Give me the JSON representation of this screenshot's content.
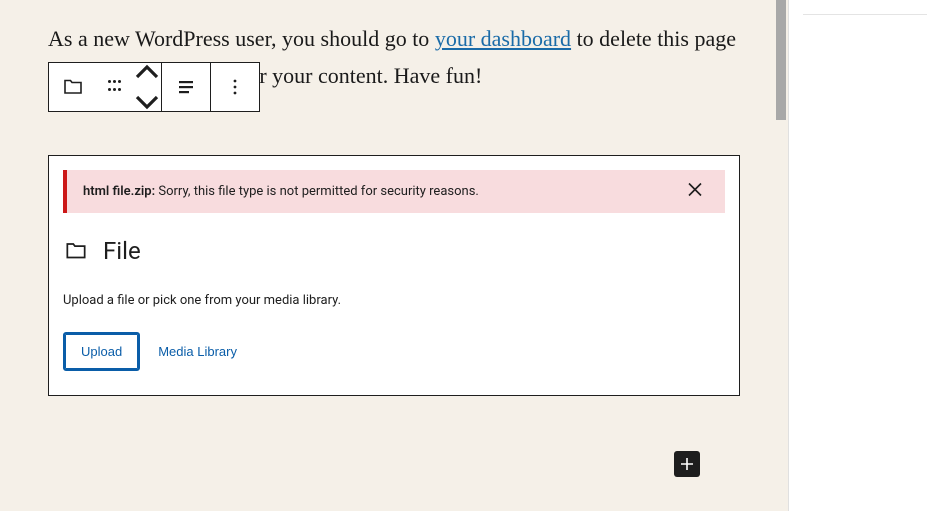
{
  "paragraph": {
    "text_before_link": "As a new WordPress user, you should go to ",
    "link_text": "your dashboard",
    "text_after_link": " to delete this page and create new pages for your content. Have fun!"
  },
  "toolbar": {
    "block_icon": "file-icon",
    "drag": "drag-handle",
    "move_up": "move-up",
    "move_down": "move-down",
    "align": "align",
    "more": "more-options"
  },
  "error": {
    "filename": "html file.zip:",
    "message": " Sorry, this file type is not permitted for security reasons."
  },
  "file_block": {
    "title": "File",
    "instructions": "Upload a file or pick one from your media library.",
    "upload_label": "Upload",
    "media_library_label": "Media Library"
  },
  "add_block": "+"
}
